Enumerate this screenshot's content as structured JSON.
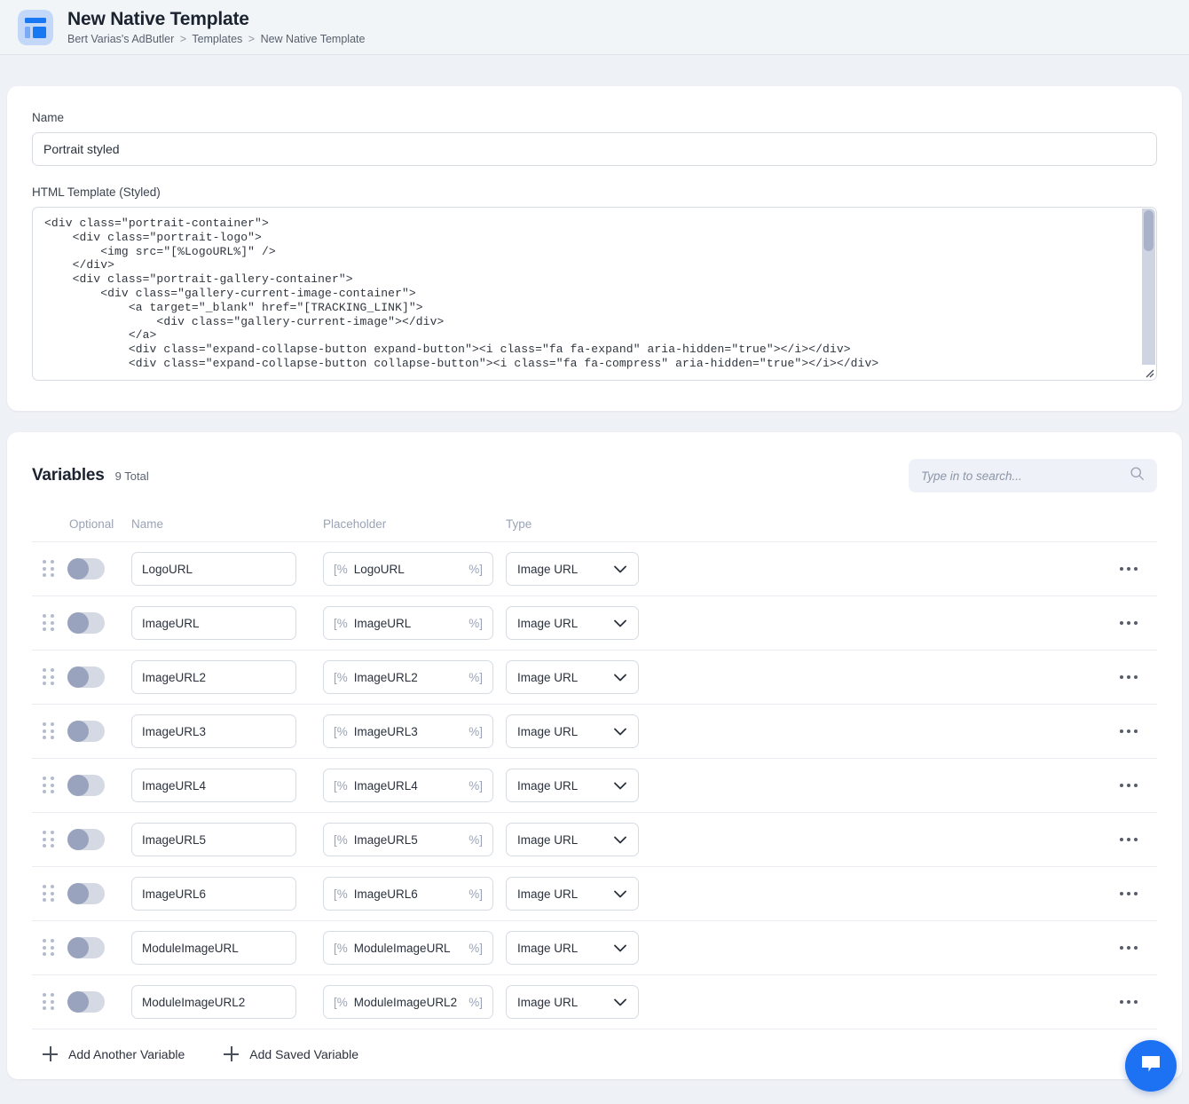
{
  "header": {
    "icon": "template-layout-icon",
    "title": "New Native Template",
    "breadcrumb": {
      "items": [
        "Bert Varias's AdButler",
        "Templates",
        "New Native Template"
      ],
      "separator": ">"
    }
  },
  "form": {
    "name_label": "Name",
    "name_value": "Portrait styled",
    "name_placeholder": "",
    "html_label": "HTML Template (Styled)",
    "html_code": "<div class=\"portrait-container\">\n    <div class=\"portrait-logo\">\n        <img src=\"[%LogoURL%]\" />\n    </div>\n    <div class=\"portrait-gallery-container\">\n        <div class=\"gallery-current-image-container\">\n            <a target=\"_blank\" href=\"[TRACKING_LINK]\">\n                <div class=\"gallery-current-image\"></div>\n            </a>\n            <div class=\"expand-collapse-button expand-button\"><i class=\"fa fa-expand\" aria-hidden=\"true\"></i></div>\n            <div class=\"expand-collapse-button collapse-button\"><i class=\"fa fa-compress\" aria-hidden=\"true\"></i></div>"
  },
  "variables": {
    "title": "Variables",
    "total_label": "9 Total",
    "search_placeholder": "Type in to search...",
    "search_value": "",
    "search_icon": "search-icon",
    "columns": {
      "optional": "Optional",
      "name": "Name",
      "placeholder": "Placeholder",
      "type": "Type"
    },
    "placeholder_open": "[%",
    "placeholder_close": "%]",
    "rows": [
      {
        "name": "LogoURL",
        "placeholder_name": "LogoURL",
        "type": "Image URL",
        "optional": false
      },
      {
        "name": "ImageURL",
        "placeholder_name": "ImageURL",
        "type": "Image URL",
        "optional": false
      },
      {
        "name": "ImageURL2",
        "placeholder_name": "ImageURL2",
        "type": "Image URL",
        "optional": false
      },
      {
        "name": "ImageURL3",
        "placeholder_name": "ImageURL3",
        "type": "Image URL",
        "optional": false
      },
      {
        "name": "ImageURL4",
        "placeholder_name": "ImageURL4",
        "type": "Image URL",
        "optional": false
      },
      {
        "name": "ImageURL5",
        "placeholder_name": "ImageURL5",
        "type": "Image URL",
        "optional": false
      },
      {
        "name": "ImageURL6",
        "placeholder_name": "ImageURL6",
        "type": "Image URL",
        "optional": false
      },
      {
        "name": "ModuleImageURL",
        "placeholder_name": "ModuleImageURL",
        "type": "Image URL",
        "optional": false
      },
      {
        "name": "ModuleImageURL2",
        "placeholder_name": "ModuleImageURL2",
        "type": "Image URL",
        "optional": false
      }
    ],
    "add_another_label": "Add Another Variable",
    "add_saved_label": "Add Saved Variable"
  },
  "chat": {
    "icon": "chat-bubble-icon"
  },
  "colors": {
    "accent": "#1877f2",
    "page_background": "#eef1f6",
    "card_background": "#ffffff",
    "muted_text": "#9aa3b6"
  }
}
